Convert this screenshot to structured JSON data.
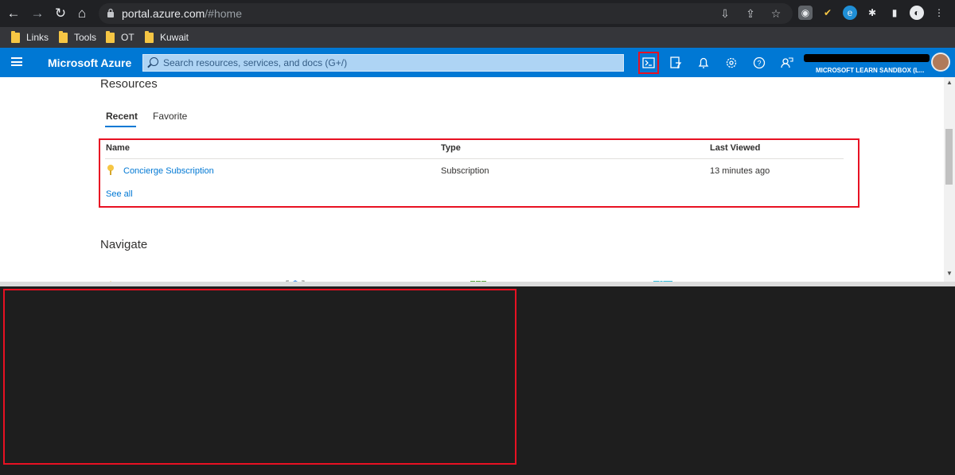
{
  "browser": {
    "url_host": "portal.azure.com",
    "url_path": "/#home",
    "bookmarks": [
      "Links",
      "Tools",
      "OT",
      "Kuwait"
    ]
  },
  "azure": {
    "brand": "Microsoft Azure",
    "search_placeholder": "Search resources, services, and docs (G+/)",
    "tenant_label": "MICROSOFT LEARN SANDBOX (L...",
    "header_icons": [
      "cloud-shell-icon",
      "directory-filter-icon",
      "notifications-icon",
      "settings-icon",
      "help-icon",
      "feedback-icon"
    ]
  },
  "resources": {
    "title": "Resources",
    "tabs": [
      "Recent",
      "Favorite"
    ],
    "active_tab": "Recent",
    "columns": [
      "Name",
      "Type",
      "Last Viewed"
    ],
    "rows": [
      {
        "name": "Concierge Subscription",
        "type": "Subscription",
        "last_viewed": "13 minutes ago"
      }
    ],
    "see_all": "See all"
  },
  "navigate": {
    "title": "Navigate"
  },
  "colors": {
    "azure_blue": "#0078d4",
    "highlight_red": "#e81123",
    "browser_dark": "#202124",
    "shell_bg": "#1e1e1e"
  }
}
